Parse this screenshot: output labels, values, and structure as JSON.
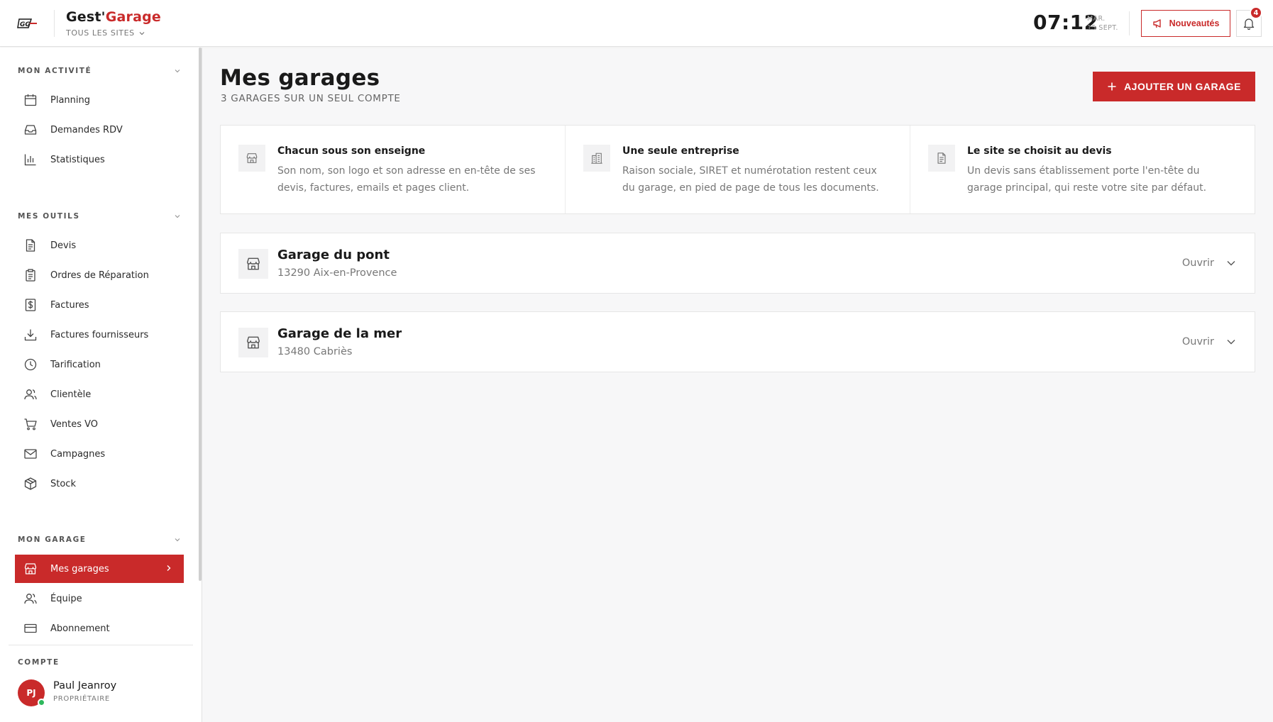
{
  "header": {
    "logo_text": "GG",
    "brand_prefix": "Gest'",
    "brand_accent": "Garage",
    "site_selector": "TOUS LES SITES",
    "time": "07:12",
    "date_day": "MAR.",
    "date_full": "15 SEPT.",
    "news_label": "Nouveautés",
    "notifications_count": "4",
    "accent_color": "#c92a2a"
  },
  "sidebar": {
    "sections": {
      "activity": "MON ACTIVITÉ",
      "tools": "MES OUTILS",
      "garage": "MON GARAGE",
      "account": "COMPTE"
    },
    "activity_items": [
      {
        "label": "Planning",
        "icon": "calendar-icon"
      },
      {
        "label": "Demandes RDV",
        "icon": "inbox-icon"
      },
      {
        "label": "Statistiques",
        "icon": "bar-chart-icon"
      }
    ],
    "tools_items": [
      {
        "label": "Devis",
        "icon": "document-icon"
      },
      {
        "label": "Ordres de Réparation",
        "icon": "clipboard-icon"
      },
      {
        "label": "Factures",
        "icon": "invoice-dollar-icon"
      },
      {
        "label": "Factures fournisseurs",
        "icon": "download-icon"
      },
      {
        "label": "Tarification",
        "icon": "clock-icon"
      },
      {
        "label": "Clientèle",
        "icon": "users-icon"
      },
      {
        "label": "Ventes VO",
        "icon": "cart-icon"
      },
      {
        "label": "Campagnes",
        "icon": "mail-icon"
      },
      {
        "label": "Stock",
        "icon": "box-icon"
      }
    ],
    "garage_items": [
      {
        "label": "Mes garages",
        "icon": "store-icon",
        "active": true
      },
      {
        "label": "Équipe",
        "icon": "users-icon"
      },
      {
        "label": "Abonnement",
        "icon": "credit-card-icon"
      }
    ],
    "user": {
      "initials": "PJ",
      "name": "Paul Jeanroy",
      "role": "PROPRIÉTAIRE"
    }
  },
  "main": {
    "title": "Mes garages",
    "subtitle": "3 GARAGES SUR UN SEUL COMPTE",
    "add_button": "AJOUTER UN GARAGE",
    "info": [
      {
        "title": "Chacun sous son enseigne",
        "text": "Son nom, son logo et son adresse en en-tête de ses devis, factures, emails et pages client.",
        "icon": "store-icon"
      },
      {
        "title": "Une seule entreprise",
        "text": "Raison sociale, SIRET et numérotation restent ceux du garage, en pied de page de tous les documents.",
        "icon": "building-icon"
      },
      {
        "title": "Le site se choisit au devis",
        "text": "Un devis sans établissement porte l'en-tête du garage principal, qui reste votre site par défaut.",
        "icon": "document-icon"
      }
    ],
    "garages": [
      {
        "name": "Garage du pont",
        "address": "13290 Aix-en-Provence",
        "action": "Ouvrir"
      },
      {
        "name": "Garage de la mer",
        "address": "13480 Cabriès",
        "action": "Ouvrir"
      }
    ]
  }
}
